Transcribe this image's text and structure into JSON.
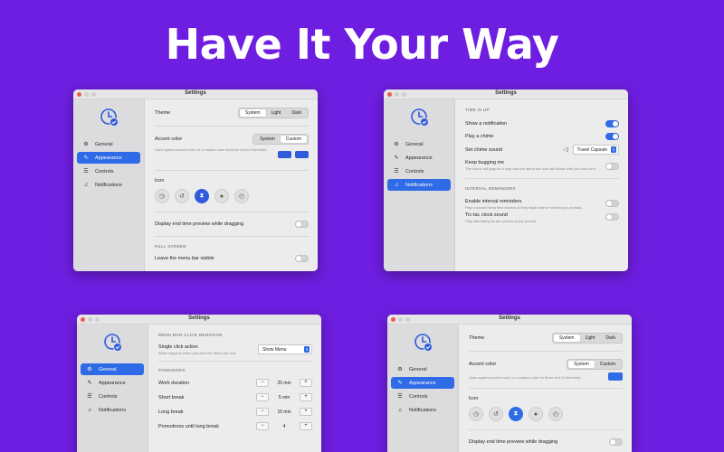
{
  "headline": "Have It Your Way",
  "nav": {
    "general": "General",
    "appearance": "Appearance",
    "controls": "Controls",
    "notifications": "Notifications"
  },
  "win1": {
    "title": "Settings",
    "theme_label": "Theme",
    "theme_options": [
      "System",
      "Light",
      "Dark"
    ],
    "theme_selected": "System",
    "accent_label": "Accent color",
    "accent_options": [
      "System",
      "Custom"
    ],
    "accent_selected": "Custom",
    "accent_desc": "Uses system accent color or a custom color for timer and UI elements.",
    "icon_label": "Icon",
    "display_end_label": "Display end time preview while dragging",
    "full_screen_section": "FULL SCREEN",
    "leave_menu_label": "Leave the menu bar visible"
  },
  "win2": {
    "title": "Settings",
    "time_up_section": "TIME IS UP",
    "show_notification": "Show a notification",
    "play_chime": "Play a chime",
    "set_chime": "Set chime sound",
    "chime_value": "Travel Capsule",
    "keep_bugging": "Keep bugging me",
    "keep_bugging_desc": "The chime will play on a loop and the menu bar icon will shake until you click on it.",
    "interval_section": "INTERVAL REMINDERS",
    "enable_interval": "Enable interval reminders",
    "enable_interval_desc": "Play a sound every few minutes to help track time or remind you of tasks.",
    "tictac": "Tic-tac clock sound",
    "tictac_desc": "Play alternating tic-tac sounds every second."
  },
  "win3": {
    "title": "Settings",
    "menu_bar_section": "MENU BAR CLICK BEHAVIOR",
    "single_click": "Single click action",
    "single_click_desc": "What happens when you click the menu bar icon",
    "single_click_value": "Show Menu",
    "pomodoro_section": "POMODORO",
    "work_duration": "Work duration",
    "work_value": "25 min",
    "short_break": "Short break",
    "short_value": "5 min",
    "long_break": "Long break",
    "long_value": "15 min",
    "pomodoros_until": "Pomodoros until long break",
    "pomodoros_value": "4"
  },
  "win4": {
    "title": "Settings",
    "theme_label": "Theme",
    "theme_options": [
      "System",
      "Light",
      "Dark"
    ],
    "accent_label": "Accent color",
    "accent_options": [
      "System",
      "Custom"
    ],
    "accent_desc": "Uses system accent color or a custom color for timer and UI elements.",
    "icon_label": "Icon",
    "display_end_label": "Display end time preview while dragging"
  },
  "colors": {
    "background": "#6e1ee0",
    "accent": "#2f6be6",
    "icon_accent": "#2f5bdc"
  },
  "icons": [
    "clock-icon",
    "refresh-clock-icon",
    "hourglass-icon",
    "record-icon",
    "stopwatch-icon"
  ]
}
